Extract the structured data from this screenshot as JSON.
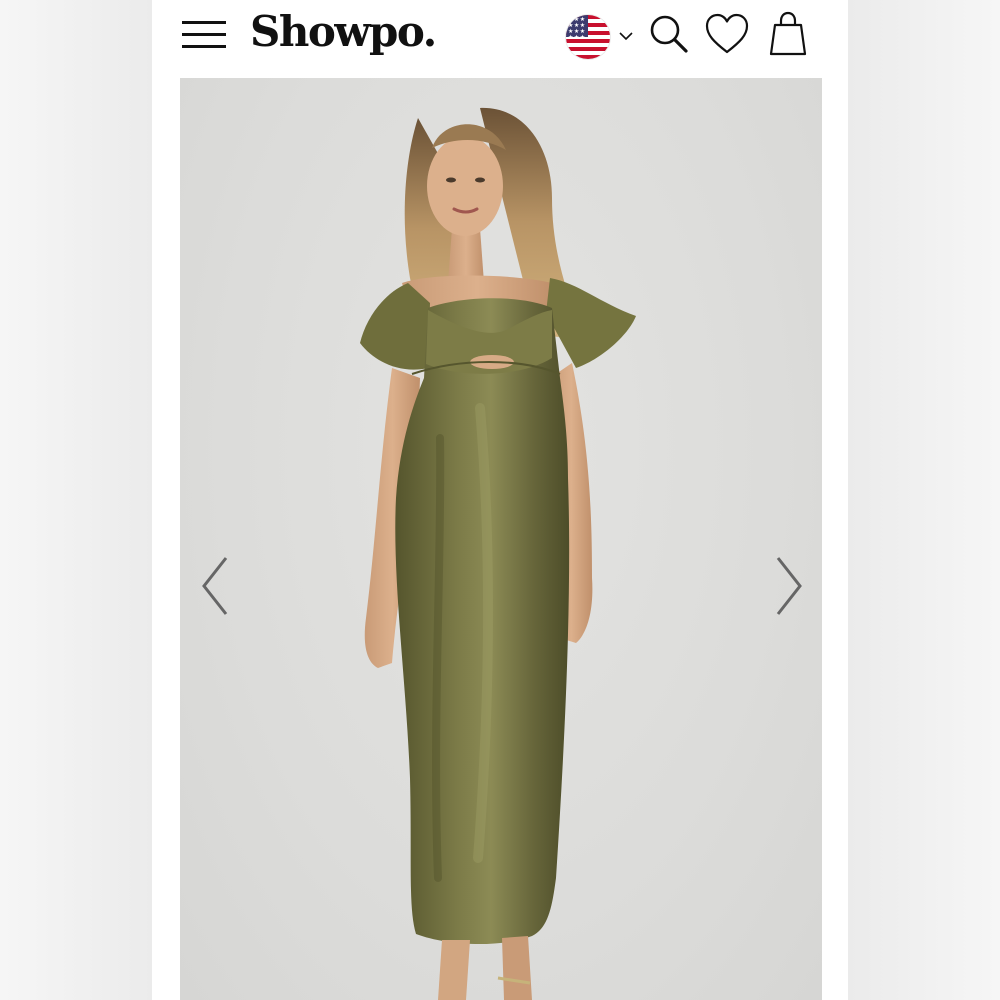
{
  "brand": {
    "name": "Showpo."
  },
  "header": {
    "icons": {
      "menu": "hamburger-menu-icon",
      "flag": "us-flag-icon",
      "locale_dropdown": "chevron-down-icon",
      "search": "search-icon",
      "wishlist": "heart-icon",
      "bag": "shopping-bag-icon"
    }
  },
  "gallery": {
    "image_subject": "model-in-olive-satin-midi-dress",
    "icons": {
      "prev": "chevron-left-icon",
      "next": "chevron-right-icon"
    }
  },
  "colors": {
    "dress": "#6e6d3d",
    "background": "#dcdcda",
    "text": "#111111"
  }
}
